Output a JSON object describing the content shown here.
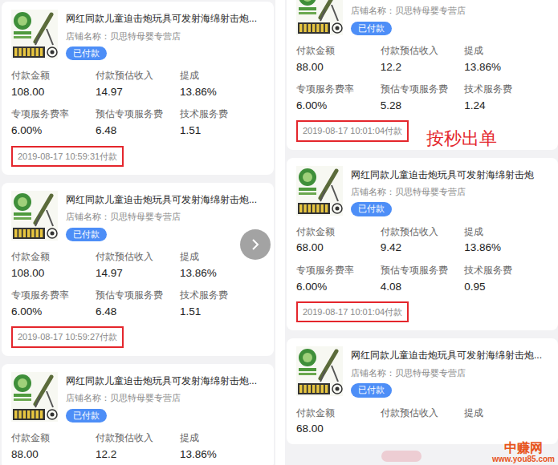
{
  "columns": [
    {
      "cards": [
        {
          "title": "网红同款儿童迫击炮玩具可发射海绵射击炮...",
          "store": "店铺名称：贝思特母婴专营店",
          "status": "已付款",
          "stats": [
            {
              "label": "付款金额",
              "value": "108.00"
            },
            {
              "label": "付款预估收入",
              "value": "14.97"
            },
            {
              "label": "提成",
              "value": "13.86%"
            },
            {
              "label": "专项服务费率",
              "value": "6.00%"
            },
            {
              "label": "预估专项服务费",
              "value": "6.48"
            },
            {
              "label": "技术服务费",
              "value": "1.51"
            }
          ],
          "time": "2019-08-17 10:59:31付款",
          "highlighted": true
        },
        {
          "title": "网红同款儿童迫击炮玩具可发射海绵射击炮...",
          "store": "店铺名称：贝思特母婴专营店",
          "status": "已付款",
          "stats": [
            {
              "label": "付款金额",
              "value": "108.00"
            },
            {
              "label": "付款预估收入",
              "value": "14.97"
            },
            {
              "label": "提成",
              "value": "13.86%"
            },
            {
              "label": "专项服务费率",
              "value": "6.00%"
            },
            {
              "label": "预估专项服务费",
              "value": "6.48"
            },
            {
              "label": "技术服务费",
              "value": "1.51"
            }
          ],
          "time": "2019-08-17 10:59:27付款",
          "highlighted": true
        },
        {
          "title": "网红同款儿童迫击炮玩具可发射海绵射击炮...",
          "store": "店铺名称：贝思特母婴专营店",
          "status": "已付款",
          "stats": [
            {
              "label": "付款金额",
              "value": "88.00"
            },
            {
              "label": "付款预估收入",
              "value": "12.2"
            },
            {
              "label": "提成",
              "value": "13.86%"
            }
          ]
        }
      ]
    },
    {
      "cards": [
        {
          "store": "店铺名称：贝思特母婴专营店",
          "status": "已付款",
          "stats": [
            {
              "label": "付款金额",
              "value": "88.00"
            },
            {
              "label": "付款预估收入",
              "value": "12.2"
            },
            {
              "label": "提成",
              "value": "13.86%"
            },
            {
              "label": "专项服务费率",
              "value": "6.00%"
            },
            {
              "label": "预估专项服务费",
              "value": "5.28"
            },
            {
              "label": "技术服务费",
              "value": "1.24"
            }
          ],
          "time": "2019-08-17 10:01:04付款",
          "highlighted": true,
          "annotation": "按秒出单"
        },
        {
          "title": "网红同款儿童迫击炮玩具可发射海绵射击炮",
          "store": "店铺名称：贝思特母婴专营店",
          "status": "已付款",
          "stats": [
            {
              "label": "付款金额",
              "value": "68.00"
            },
            {
              "label": "付款预估收入",
              "value": "9.42"
            },
            {
              "label": "提成",
              "value": "13.86%"
            },
            {
              "label": "专项服务费率",
              "value": "6.00%"
            },
            {
              "label": "预估专项服务费",
              "value": "4.08"
            },
            {
              "label": "技术服务费",
              "value": "0.95"
            }
          ],
          "time": "2019-08-17 10:01:04付款",
          "highlighted": true
        },
        {
          "title": "网红同款儿童迫击炮玩具可发射海绵射击炮...",
          "store": "店铺名称：贝思特母婴专营店",
          "status": "已付款",
          "stats": [
            {
              "label": "付款金额",
              "value": "68.00"
            },
            {
              "label": "付款预估收入"
            },
            {
              "label": "提成"
            }
          ]
        }
      ]
    }
  ],
  "watermark": {
    "name": "中赚网",
    "url": "www.you85.com"
  }
}
